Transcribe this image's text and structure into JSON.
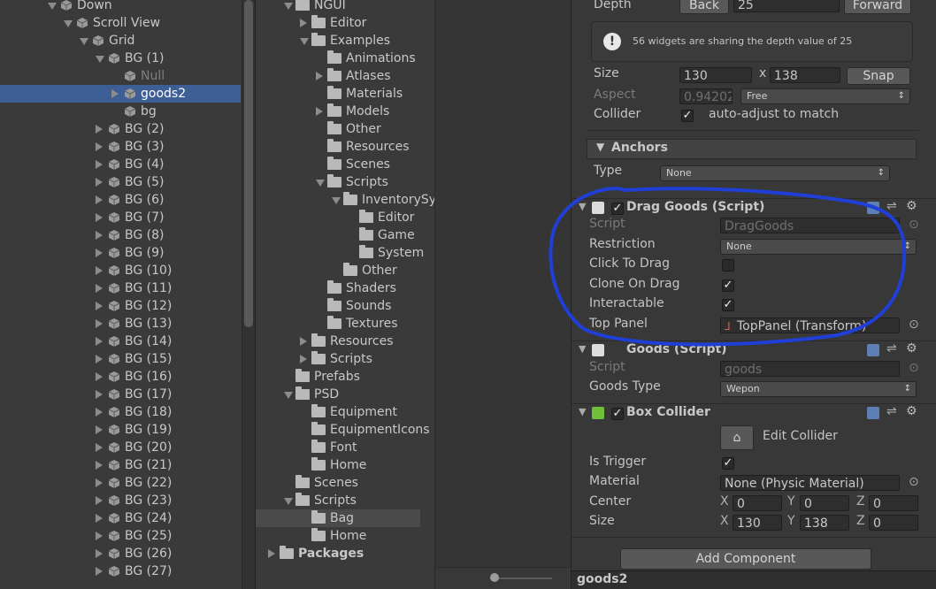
{
  "hierarchy": {
    "items": [
      {
        "label": "Down",
        "indent": 1,
        "expand": "down",
        "icon": true
      },
      {
        "label": "Scroll View",
        "indent": 2,
        "expand": "down",
        "icon": true
      },
      {
        "label": "Grid",
        "indent": 3,
        "expand": "down",
        "icon": true
      },
      {
        "label": "BG (1)",
        "indent": 4,
        "expand": "down",
        "icon": true
      },
      {
        "label": "Null",
        "indent": 5,
        "expand": "",
        "icon": true,
        "dim": true
      },
      {
        "label": "goods2",
        "indent": 5,
        "expand": "right",
        "icon": true,
        "selected": true
      },
      {
        "label": "bg",
        "indent": 5,
        "expand": "",
        "icon": true
      },
      {
        "label": "BG (2)",
        "indent": 4,
        "expand": "right",
        "icon": true
      },
      {
        "label": "BG (3)",
        "indent": 4,
        "expand": "right",
        "icon": true
      },
      {
        "label": "BG (4)",
        "indent": 4,
        "expand": "right",
        "icon": true
      },
      {
        "label": "BG (5)",
        "indent": 4,
        "expand": "right",
        "icon": true
      },
      {
        "label": "BG (6)",
        "indent": 4,
        "expand": "right",
        "icon": true
      },
      {
        "label": "BG (7)",
        "indent": 4,
        "expand": "right",
        "icon": true
      },
      {
        "label": "BG (8)",
        "indent": 4,
        "expand": "right",
        "icon": true
      },
      {
        "label": "BG (9)",
        "indent": 4,
        "expand": "right",
        "icon": true
      },
      {
        "label": "BG (10)",
        "indent": 4,
        "expand": "right",
        "icon": true
      },
      {
        "label": "BG (11)",
        "indent": 4,
        "expand": "right",
        "icon": true
      },
      {
        "label": "BG (12)",
        "indent": 4,
        "expand": "right",
        "icon": true
      },
      {
        "label": "BG (13)",
        "indent": 4,
        "expand": "right",
        "icon": true
      },
      {
        "label": "BG (14)",
        "indent": 4,
        "expand": "right",
        "icon": true
      },
      {
        "label": "BG (15)",
        "indent": 4,
        "expand": "right",
        "icon": true
      },
      {
        "label": "BG (16)",
        "indent": 4,
        "expand": "right",
        "icon": true
      },
      {
        "label": "BG (17)",
        "indent": 4,
        "expand": "right",
        "icon": true
      },
      {
        "label": "BG (18)",
        "indent": 4,
        "expand": "right",
        "icon": true
      },
      {
        "label": "BG (19)",
        "indent": 4,
        "expand": "right",
        "icon": true
      },
      {
        "label": "BG (20)",
        "indent": 4,
        "expand": "right",
        "icon": true
      },
      {
        "label": "BG (21)",
        "indent": 4,
        "expand": "right",
        "icon": true
      },
      {
        "label": "BG (22)",
        "indent": 4,
        "expand": "right",
        "icon": true
      },
      {
        "label": "BG (23)",
        "indent": 4,
        "expand": "right",
        "icon": true
      },
      {
        "label": "BG (24)",
        "indent": 4,
        "expand": "right",
        "icon": true
      },
      {
        "label": "BG (25)",
        "indent": 4,
        "expand": "right",
        "icon": true
      },
      {
        "label": "BG (26)",
        "indent": 4,
        "expand": "right",
        "icon": true
      },
      {
        "label": "BG (27)",
        "indent": 4,
        "expand": "right",
        "icon": true
      }
    ]
  },
  "project": {
    "items": [
      {
        "label": "NGUI",
        "indent": 1,
        "expand": "down"
      },
      {
        "label": "Editor",
        "indent": 2,
        "expand": "right"
      },
      {
        "label": "Examples",
        "indent": 2,
        "expand": "down"
      },
      {
        "label": "Animations",
        "indent": 3,
        "expand": ""
      },
      {
        "label": "Atlases",
        "indent": 3,
        "expand": "right"
      },
      {
        "label": "Materials",
        "indent": 3,
        "expand": ""
      },
      {
        "label": "Models",
        "indent": 3,
        "expand": "right"
      },
      {
        "label": "Other",
        "indent": 3,
        "expand": ""
      },
      {
        "label": "Resources",
        "indent": 3,
        "expand": ""
      },
      {
        "label": "Scenes",
        "indent": 3,
        "expand": ""
      },
      {
        "label": "Scripts",
        "indent": 3,
        "expand": "down"
      },
      {
        "label": "InventorySy",
        "indent": 4,
        "expand": "down"
      },
      {
        "label": "Editor",
        "indent": 5,
        "expand": ""
      },
      {
        "label": "Game",
        "indent": 5,
        "expand": ""
      },
      {
        "label": "System",
        "indent": 5,
        "expand": ""
      },
      {
        "label": "Other",
        "indent": 4,
        "expand": ""
      },
      {
        "label": "Shaders",
        "indent": 3,
        "expand": ""
      },
      {
        "label": "Sounds",
        "indent": 3,
        "expand": ""
      },
      {
        "label": "Textures",
        "indent": 3,
        "expand": ""
      },
      {
        "label": "Resources",
        "indent": 2,
        "expand": "right"
      },
      {
        "label": "Scripts",
        "indent": 2,
        "expand": "right"
      },
      {
        "label": "Prefabs",
        "indent": 1,
        "expand": ""
      },
      {
        "label": "PSD",
        "indent": 1,
        "expand": "down"
      },
      {
        "label": "Equipment",
        "indent": 2,
        "expand": ""
      },
      {
        "label": "EquipmentIcons",
        "indent": 2,
        "expand": ""
      },
      {
        "label": "Font",
        "indent": 2,
        "expand": ""
      },
      {
        "label": "Home",
        "indent": 2,
        "expand": ""
      },
      {
        "label": "Scenes",
        "indent": 1,
        "expand": ""
      },
      {
        "label": "Scripts",
        "indent": 1,
        "expand": "down"
      },
      {
        "label": "Bag",
        "indent": 2,
        "expand": "",
        "selected": true
      },
      {
        "label": "Home",
        "indent": 2,
        "expand": ""
      },
      {
        "label": "Packages",
        "indent": 0,
        "expand": "right"
      }
    ]
  },
  "inspector": {
    "depth": {
      "label": "Depth",
      "back": "Back",
      "value": "25",
      "forward": "Forward"
    },
    "warning": "56 widgets are sharing the depth value of 25",
    "size": {
      "label": "Size",
      "w": "130",
      "x": "x",
      "h": "138",
      "snap": "Snap"
    },
    "aspect": {
      "label": "Aspect",
      "value": "0.94202",
      "mode": "Free"
    },
    "collider": {
      "label": "Collider",
      "text": "auto-adjust to match"
    },
    "anchors": {
      "title": "Anchors",
      "type_label": "Type",
      "type_value": "None"
    },
    "drag_goods": {
      "title": "Drag Goods (Script)",
      "script_label": "Script",
      "script_value": "DragGoods",
      "restriction_label": "Restriction",
      "restriction_value": "None",
      "click_label": "Click To Drag",
      "clone_label": "Clone On Drag",
      "interactable_label": "Interactable",
      "top_panel_label": "Top Panel",
      "top_panel_value": "TopPanel (Transform)"
    },
    "goods": {
      "title": "Goods (Script)",
      "script_label": "Script",
      "script_value": "goods",
      "type_label": "Goods Type",
      "type_value": "Wepon"
    },
    "box_collider": {
      "title": "Box Collider",
      "edit": "Edit Collider",
      "trigger_label": "Is Trigger",
      "material_label": "Material",
      "material_value": "None (Physic Material)",
      "center_label": "Center",
      "cx": "0",
      "cy": "0",
      "cz": "0",
      "size_label": "Size",
      "sx": "130",
      "sy": "138",
      "sz": "0"
    },
    "add_component": "Add Component",
    "axis": {
      "x": "X",
      "y": "Y",
      "z": "Z"
    }
  },
  "footer": {
    "object_name": "goods2"
  },
  "colors": {
    "highlight": "#1f3fd6",
    "selection": "#3e5f96"
  }
}
